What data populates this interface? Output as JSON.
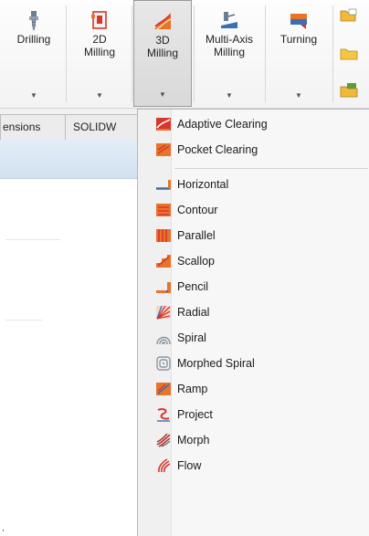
{
  "ribbon": {
    "buttons": [
      {
        "label": "Drilling",
        "icon": "drilling-icon"
      },
      {
        "label": "2D\nMilling",
        "icon": "2d-milling-icon"
      },
      {
        "label": "3D\nMilling",
        "icon": "3d-milling-icon",
        "active": true
      },
      {
        "label": "Multi-Axis\nMilling",
        "icon": "multi-axis-milling-icon"
      },
      {
        "label": "Turning",
        "icon": "turning-icon"
      }
    ],
    "dropdown_arrow": "▼"
  },
  "tabs": [
    {
      "label": "ensions"
    },
    {
      "label": "SOLIDW"
    }
  ],
  "menu": {
    "items": [
      {
        "label": "Adaptive Clearing",
        "icon": "adaptive-clearing-icon"
      },
      {
        "label": "Pocket Clearing",
        "icon": "pocket-clearing-icon"
      },
      {
        "label": "Horizontal",
        "icon": "horizontal-icon"
      },
      {
        "label": "Contour",
        "icon": "contour-icon"
      },
      {
        "label": "Parallel",
        "icon": "parallel-icon"
      },
      {
        "label": "Scallop",
        "icon": "scallop-icon"
      },
      {
        "label": "Pencil",
        "icon": "pencil-icon"
      },
      {
        "label": "Radial",
        "icon": "radial-icon"
      },
      {
        "label": "Spiral",
        "icon": "spiral-icon"
      },
      {
        "label": "Morphed Spiral",
        "icon": "morphed-spiral-icon"
      },
      {
        "label": "Ramp",
        "icon": "ramp-icon"
      },
      {
        "label": "Project",
        "icon": "project-icon"
      },
      {
        "label": "Morph",
        "icon": "morph-icon"
      },
      {
        "label": "Flow",
        "icon": "flow-icon"
      }
    ]
  },
  "panel": {
    "tick": ","
  },
  "colors": {
    "accent_orange": "#e8742a",
    "accent_red": "#d9362b",
    "accent_blue": "#3a6fb5",
    "active_button_bg": "#dcdcdc"
  }
}
